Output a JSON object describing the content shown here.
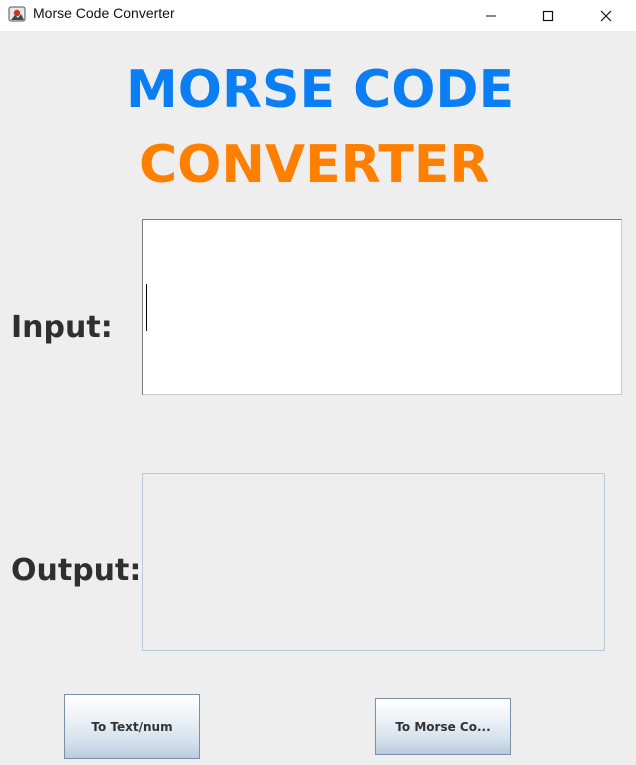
{
  "window": {
    "title": "Morse Code Converter",
    "controls": {
      "minimize": "─",
      "maximize": "☐",
      "close": "✕"
    }
  },
  "heading": {
    "line1": "MORSE CODE",
    "line2": "CONVERTER",
    "line1_color": "#0a7ef2",
    "line2_color": "#ff7f00"
  },
  "form": {
    "input_label": "Input:",
    "input_value": "",
    "output_label": "Output:",
    "output_value": ""
  },
  "buttons": {
    "to_text": "To Text/num",
    "to_morse": "To Morse Co..."
  }
}
